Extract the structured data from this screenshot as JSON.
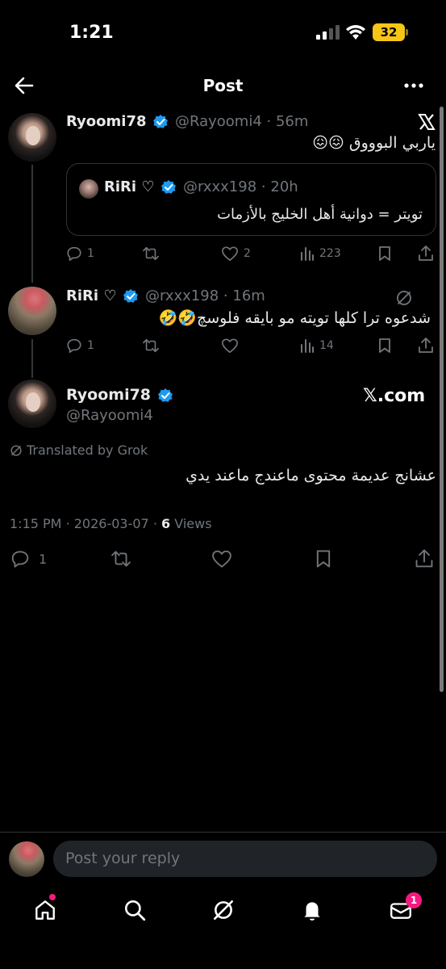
{
  "status_bar": {
    "time": "1:21",
    "battery": "32"
  },
  "header": {
    "title": "Post"
  },
  "thread": {
    "tweet1": {
      "name": "Ryoomi78",
      "handle": "@Rayoomi4",
      "time": "56m",
      "text": "ياربي البوووق 😖😖",
      "quote": {
        "name": "RiRi ♡",
        "handle": "@rxxx198",
        "time": "20h",
        "text": "تويتر = دوانية أهل الخليج بالأزمات"
      },
      "replies": "1",
      "likes": "2",
      "views": "223"
    },
    "tweet2": {
      "name": "RiRi ♡",
      "handle": "@rxxx198",
      "time": "16m",
      "text": "شدعوه ترا كلها تويته مو بايقه فلوسچ🤣🤣",
      "replies": "1",
      "views": "14"
    },
    "main": {
      "name": "Ryoomi78",
      "handle": "@Rayoomi4",
      "badge": "𝕏.com",
      "translated": "Translated by Grok",
      "text": "عشانج عديمة محتوى ماعندج ماعند يدي",
      "time": "1:15 PM",
      "date": "2026-03-07",
      "views_count": "6",
      "views_label": "Views",
      "replies": "1"
    }
  },
  "reply": {
    "placeholder": "Post your reply"
  },
  "bottom_nav": {
    "messages_badge": "1"
  },
  "colors": {
    "accent": "#1d9bf0",
    "badge": "#f91880",
    "background": "#000000",
    "muted": "#71767b"
  }
}
